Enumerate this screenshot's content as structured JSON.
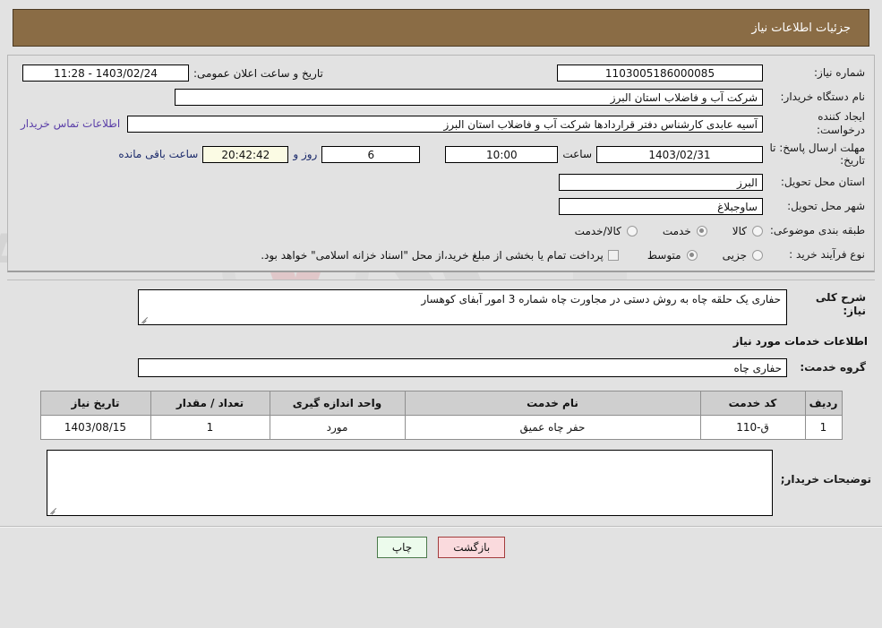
{
  "header": {
    "title": "جزئیات اطلاعات نیاز"
  },
  "form": {
    "need_number_label": "شماره نیاز:",
    "need_number_value": "1103005186000085",
    "announce_label": "تاریخ و ساعت اعلان عمومی:",
    "announce_value": "1403/02/24 - 11:28",
    "buyer_org_label": "نام دستگاه خریدار:",
    "buyer_org_value": "شرکت آب و فاضلاب استان البرز",
    "creator_label": "ایجاد کننده درخواست:",
    "creator_value": "آسیه عابدی کارشناس دفتر قراردادها شرکت آب و فاضلاب استان البرز",
    "contact_link": "اطلاعات تماس خریدار",
    "deadline_label": "مهلت ارسال پاسخ: تا تاریخ:",
    "deadline_date": "1403/02/31",
    "hour_label": "ساعت",
    "deadline_time": "10:00",
    "remaining_days": "6",
    "days_and_label": "روز و",
    "remaining_time": "20:42:42",
    "remaining_suffix": "ساعت باقی مانده",
    "province_label": "استان محل تحویل:",
    "province_value": "البرز",
    "city_label": "شهر محل تحویل:",
    "city_value": "ساوجبلاغ",
    "category_label": "طبقه بندی موضوعی:",
    "category_options": [
      {
        "label": "کالا",
        "selected": false
      },
      {
        "label": "خدمت",
        "selected": true
      },
      {
        "label": "کالا/خدمت",
        "selected": false
      }
    ],
    "process_label": "نوع فرآیند خرید :",
    "process_options": [
      {
        "label": "جزیی",
        "selected": false
      },
      {
        "label": "متوسط",
        "selected": true
      }
    ],
    "treasury_note": "پرداخت تمام یا بخشی از مبلغ خرید،از محل \"اسناد خزانه اسلامی\" خواهد بود."
  },
  "description": {
    "label": "شرح کلی نیاز:",
    "value": "حفاری یک حلقه چاه به روش دستی در مجاورت چاه شماره 3 امور آبفای کوهسار"
  },
  "services_section": {
    "heading": "اطلاعات خدمات مورد نیاز",
    "group_label": "گروه خدمت:",
    "group_value": "حفاری چاه"
  },
  "table": {
    "columns": [
      "ردیف",
      "کد خدمت",
      "نام خدمت",
      "واحد اندازه گیری",
      "تعداد / مقدار",
      "تاریخ نیاز"
    ],
    "rows": [
      {
        "row": "1",
        "code": "ق-110",
        "name": "حفر چاه عمیق",
        "unit": "مورد",
        "qty": "1",
        "date": "1403/08/15"
      }
    ]
  },
  "buyer_notes": {
    "label": "توضیحات خریدار;",
    "value": ""
  },
  "footer": {
    "print_label": "چاپ",
    "back_label": "بازگشت"
  },
  "watermark": {
    "text": "AriaTender.net"
  },
  "colors": {
    "header_bg": "#8a6c45",
    "page_bg": "#e2e2e2",
    "link": "#5b3fa8",
    "countdown_bg": "#fbfbe4",
    "print_btn_bg": "#ecfbec",
    "back_btn_bg": "#fadadd"
  }
}
